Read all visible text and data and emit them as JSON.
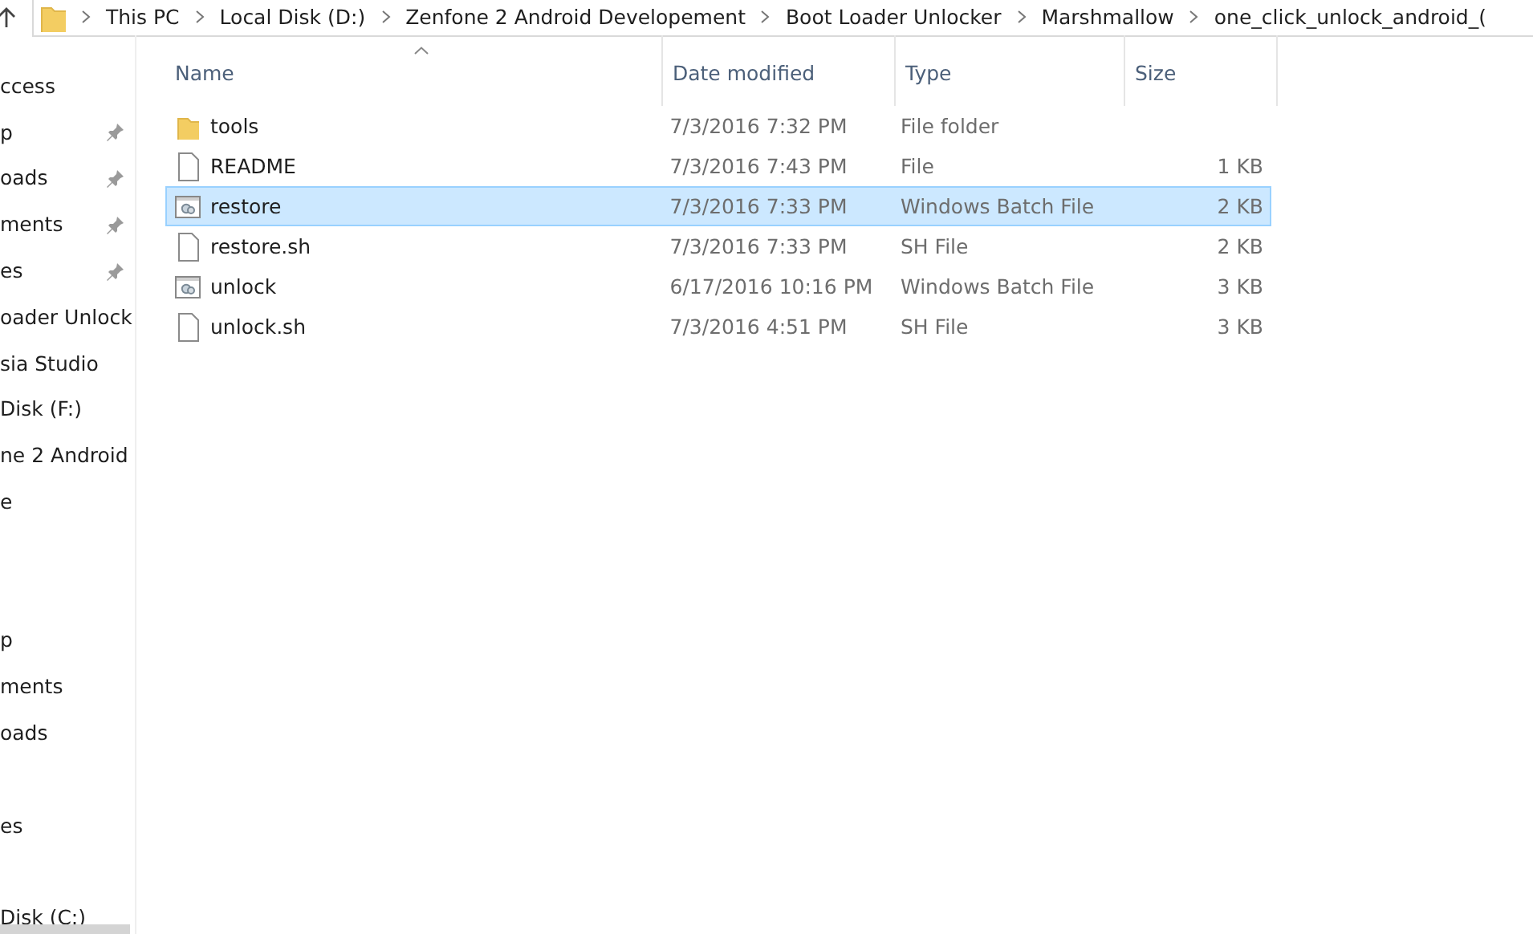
{
  "address_bar": {
    "path": [
      {
        "label": "This PC"
      },
      {
        "label": "Local Disk (D:)"
      },
      {
        "label": "Zenfone 2 Android Developement"
      },
      {
        "label": "Boot Loader Unlocker"
      },
      {
        "label": "Marshmallow"
      },
      {
        "label": "one_click_unlock_android_("
      }
    ]
  },
  "sidebar": {
    "items": [
      {
        "kind": "item",
        "label": "ccess",
        "pinned": false
      },
      {
        "kind": "item",
        "label": "p",
        "pinned": true
      },
      {
        "kind": "item",
        "label": "oads",
        "pinned": true
      },
      {
        "kind": "item",
        "label": "ments",
        "pinned": true
      },
      {
        "kind": "item",
        "label": "es",
        "pinned": true
      },
      {
        "kind": "item",
        "label": "oader Unlock",
        "pinned": false
      },
      {
        "kind": "item",
        "label": "sia Studio",
        "pinned": false
      },
      {
        "kind": "item",
        "label": "Disk (F:)",
        "pinned": false
      },
      {
        "kind": "item",
        "label": "ne 2 Android",
        "pinned": false
      },
      {
        "kind": "item",
        "label": "e",
        "pinned": false
      },
      {
        "kind": "gap"
      },
      {
        "kind": "gap"
      },
      {
        "kind": "item",
        "label": "p",
        "pinned": false
      },
      {
        "kind": "item",
        "label": "ments",
        "pinned": false
      },
      {
        "kind": "item",
        "label": "oads",
        "pinned": false
      },
      {
        "kind": "gap"
      },
      {
        "kind": "item",
        "label": "es",
        "pinned": false
      },
      {
        "kind": "gap"
      },
      {
        "kind": "item",
        "label": "Disk (C:)",
        "pinned": false
      }
    ]
  },
  "file_list": {
    "columns": [
      {
        "label": "Name",
        "sorted": true
      },
      {
        "label": "Date modified",
        "sorted": false
      },
      {
        "label": "Type",
        "sorted": false
      },
      {
        "label": "Size",
        "sorted": false
      }
    ],
    "rows": [
      {
        "kind": "folder",
        "name": "tools",
        "date": "7/3/2016 7:32 PM",
        "type": "File folder",
        "selected": false
      },
      {
        "kind": "file",
        "name": "README",
        "date": "7/3/2016 7:43 PM",
        "type": "File",
        "size": "1 KB",
        "selected": false
      },
      {
        "kind": "batch",
        "name": "restore",
        "date": "7/3/2016 7:33 PM",
        "type": "Windows Batch File",
        "size": "2 KB",
        "selected": true
      },
      {
        "kind": "file",
        "name": "restore.sh",
        "date": "7/3/2016 7:33 PM",
        "type": "SH File",
        "size": "2 KB",
        "selected": false
      },
      {
        "kind": "batch",
        "name": "unlock",
        "date": "6/17/2016 10:16 PM",
        "type": "Windows Batch File",
        "size": "3 KB",
        "selected": false
      },
      {
        "kind": "file",
        "name": "unlock.sh",
        "date": "7/3/2016 4:51 PM",
        "type": "SH File",
        "size": "3 KB",
        "selected": false
      }
    ]
  }
}
